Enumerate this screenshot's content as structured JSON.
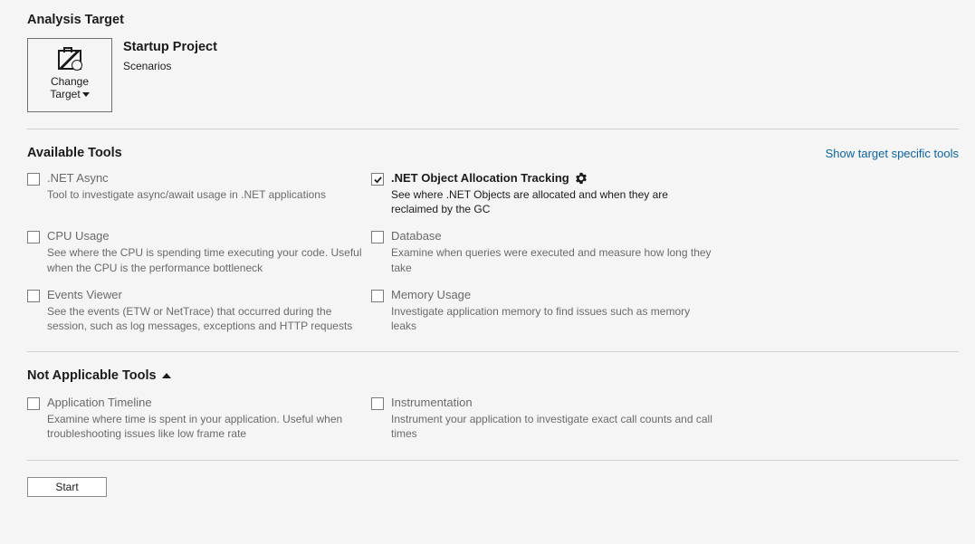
{
  "analysisTarget": {
    "header": "Analysis Target",
    "changeTarget": {
      "line1": "Change",
      "line2": "Target"
    },
    "projectTitle": "Startup Project",
    "projectSub": "Scenarios"
  },
  "availableTools": {
    "header": "Available Tools",
    "showSpecificLink": "Show target specific tools",
    "tools": [
      {
        "id": "net-async",
        "label": ".NET Async",
        "desc": "Tool to investigate async/await usage in .NET applications",
        "checked": false,
        "hasGear": false
      },
      {
        "id": "net-obj-alloc",
        "label": ".NET Object Allocation Tracking",
        "desc": "See where .NET Objects are allocated and when they are reclaimed by the GC",
        "checked": true,
        "hasGear": true
      },
      {
        "id": "cpu-usage",
        "label": "CPU Usage",
        "desc": "See where the CPU is spending time executing your code. Useful when the CPU is the performance bottleneck",
        "checked": false,
        "hasGear": false
      },
      {
        "id": "database",
        "label": "Database",
        "desc": "Examine when queries were executed and measure how long they take",
        "checked": false,
        "hasGear": false
      },
      {
        "id": "events-viewer",
        "label": "Events Viewer",
        "desc": "See the events (ETW or NetTrace) that occurred during the session, such as log messages, exceptions and HTTP requests",
        "checked": false,
        "hasGear": false
      },
      {
        "id": "memory-usage",
        "label": "Memory Usage",
        "desc": "Investigate application memory to find issues such as memory leaks",
        "checked": false,
        "hasGear": false
      }
    ]
  },
  "notApplicable": {
    "header": "Not Applicable Tools",
    "tools": [
      {
        "id": "app-timeline",
        "label": "Application Timeline",
        "desc": "Examine where time is spent in your application. Useful when troubleshooting issues like low frame rate",
        "checked": false
      },
      {
        "id": "instrumentation",
        "label": "Instrumentation",
        "desc": "Instrument your application to investigate exact call counts and call times",
        "checked": false
      }
    ]
  },
  "footer": {
    "startLabel": "Start"
  }
}
